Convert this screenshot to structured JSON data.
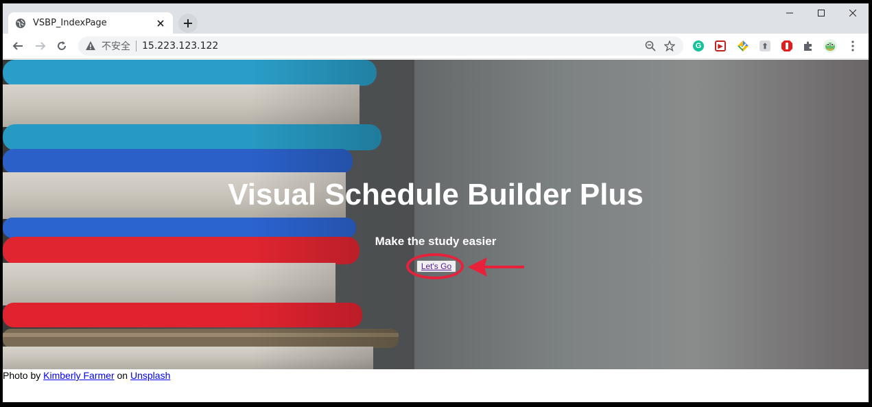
{
  "browser": {
    "tab_title": "VSBP_IndexPage",
    "security_label": "不安全",
    "url": "15.223.123.122"
  },
  "page": {
    "title": "Visual Schedule Builder Plus",
    "subtitle": "Make the study easier",
    "button_label": "Let's Go",
    "credit": {
      "prefix": "Photo by ",
      "author": "Kimberly Farmer",
      "middle": " on ",
      "site": "Unsplash"
    }
  },
  "colors": {
    "annotation": "#e8203a",
    "link": "#0000ee",
    "visited_link": "#551a8b"
  },
  "icons": {
    "favicon": "globe-icon",
    "warning": "warning-icon"
  }
}
